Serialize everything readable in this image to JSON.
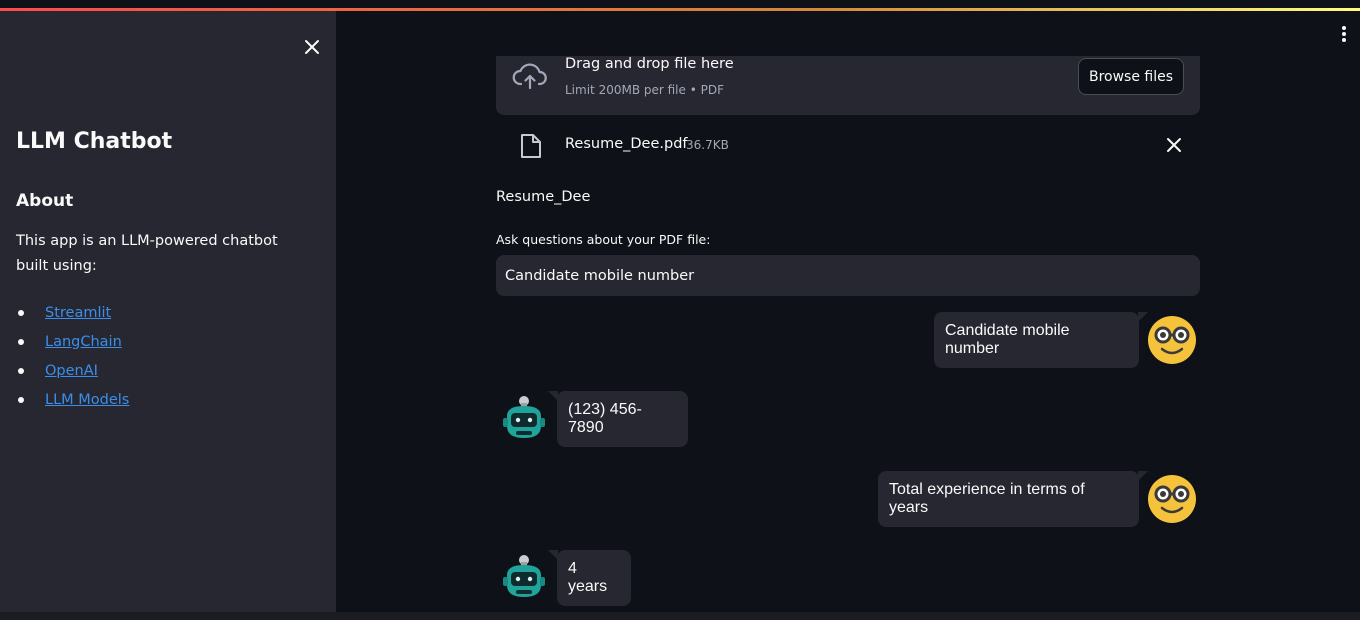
{
  "sidebar": {
    "title": "LLM Chatbot",
    "about_heading": "About",
    "description": "This app is an LLM-powered chatbot built using:",
    "links": [
      "Streamlit",
      "LangChain",
      "OpenAI",
      "LLM Models"
    ]
  },
  "uploader": {
    "drag_text": "Drag and drop file here",
    "limit_text": "Limit 200MB per file • PDF",
    "browse_label": "Browse files",
    "file_name": "Resume_Dee.pdf",
    "file_size": "36.7KB"
  },
  "document_title": "Resume_Dee",
  "question": {
    "label": "Ask questions about your PDF file:",
    "value": "Candidate mobile number"
  },
  "chat": [
    {
      "role": "user",
      "text": "Candidate mobile number"
    },
    {
      "role": "bot",
      "text": "(123) 456-7890"
    },
    {
      "role": "user",
      "text": "Total experience in terms of years"
    },
    {
      "role": "bot",
      "text": "4 years"
    }
  ],
  "icons": {
    "close": "close-icon",
    "menu": "kebab-menu-icon",
    "upload": "cloud-upload-icon",
    "file": "file-icon",
    "user_avatar": "nerd-face-icon",
    "bot_avatar": "robot-icon"
  },
  "colors": {
    "background": "#0e1117",
    "sidebar": "#262730",
    "link": "#3b8eea",
    "bubble": "#262730"
  }
}
